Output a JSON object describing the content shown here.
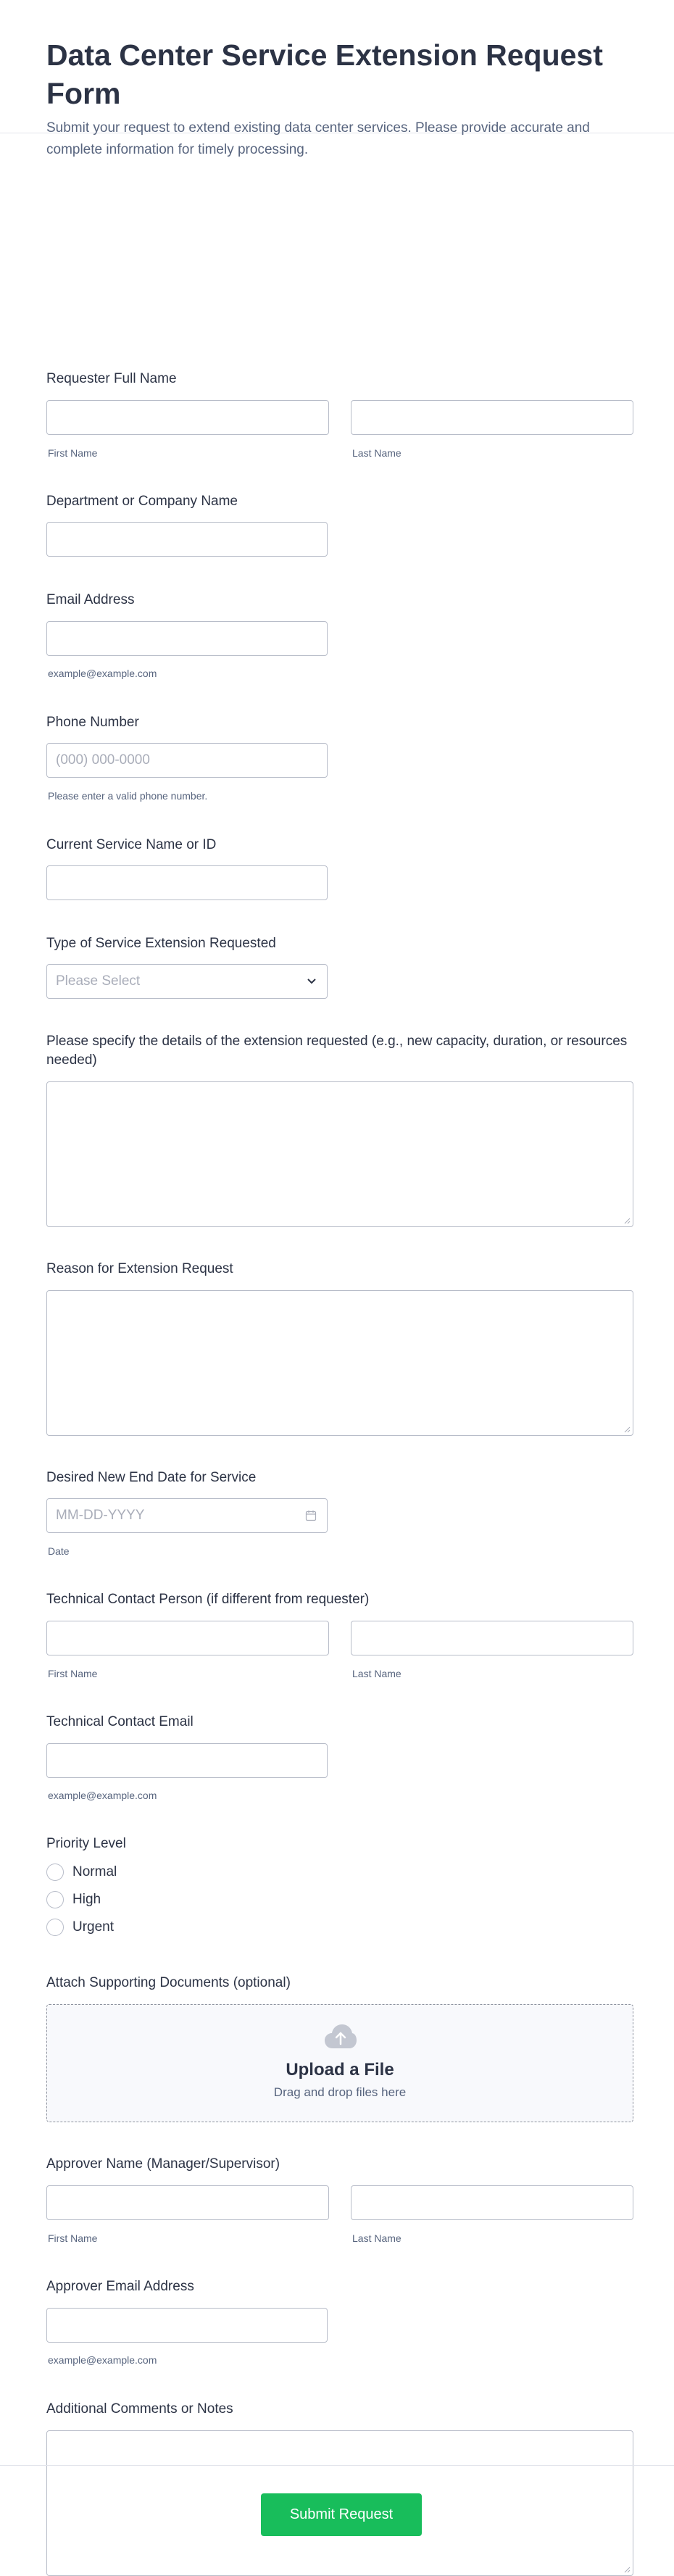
{
  "header": {
    "title": "Data Center Service Extension Request Form",
    "description": "Submit your request to extend existing data center services. Please provide accurate and complete information for timely processing."
  },
  "fields": {
    "requester_name": {
      "label": "Requester Full Name",
      "first_sublabel": "First Name",
      "last_sublabel": "Last Name"
    },
    "department": {
      "label": "Department or Company Name"
    },
    "email": {
      "label": "Email Address",
      "sublabel": "example@example.com"
    },
    "phone": {
      "label": "Phone Number",
      "placeholder": "(000) 000-0000",
      "sublabel": "Please enter a valid phone number."
    },
    "current_service": {
      "label": "Current Service Name or ID"
    },
    "extension_type": {
      "label": "Type of Service Extension Requested",
      "placeholder": "Please Select"
    },
    "extension_details": {
      "label": "Please specify the details of the extension requested (e.g., new capacity, duration, or resources needed)"
    },
    "reason": {
      "label": "Reason for Extension Request"
    },
    "end_date": {
      "label": "Desired New End Date for Service",
      "placeholder": "MM-DD-YYYY",
      "sublabel": "Date"
    },
    "technical_contact": {
      "label": "Technical Contact Person (if different from requester)",
      "first_sublabel": "First Name",
      "last_sublabel": "Last Name"
    },
    "technical_email": {
      "label": "Technical Contact Email",
      "sublabel": "example@example.com"
    },
    "priority": {
      "label": "Priority Level",
      "options": [
        "Normal",
        "High",
        "Urgent"
      ]
    },
    "attachments": {
      "label": "Attach Supporting Documents (optional)",
      "upload_title": "Upload a File",
      "upload_sub": "Drag and drop files here",
      "icon": "cloud-upload-icon"
    },
    "approver_name": {
      "label": "Approver Name (Manager/Supervisor)",
      "first_sublabel": "First Name",
      "last_sublabel": "Last Name"
    },
    "approver_email": {
      "label": "Approver Email Address",
      "sublabel": "example@example.com"
    },
    "comments": {
      "label": "Additional Comments or Notes"
    }
  },
  "submit": {
    "label": "Submit Request",
    "color": "#18bd5b"
  }
}
